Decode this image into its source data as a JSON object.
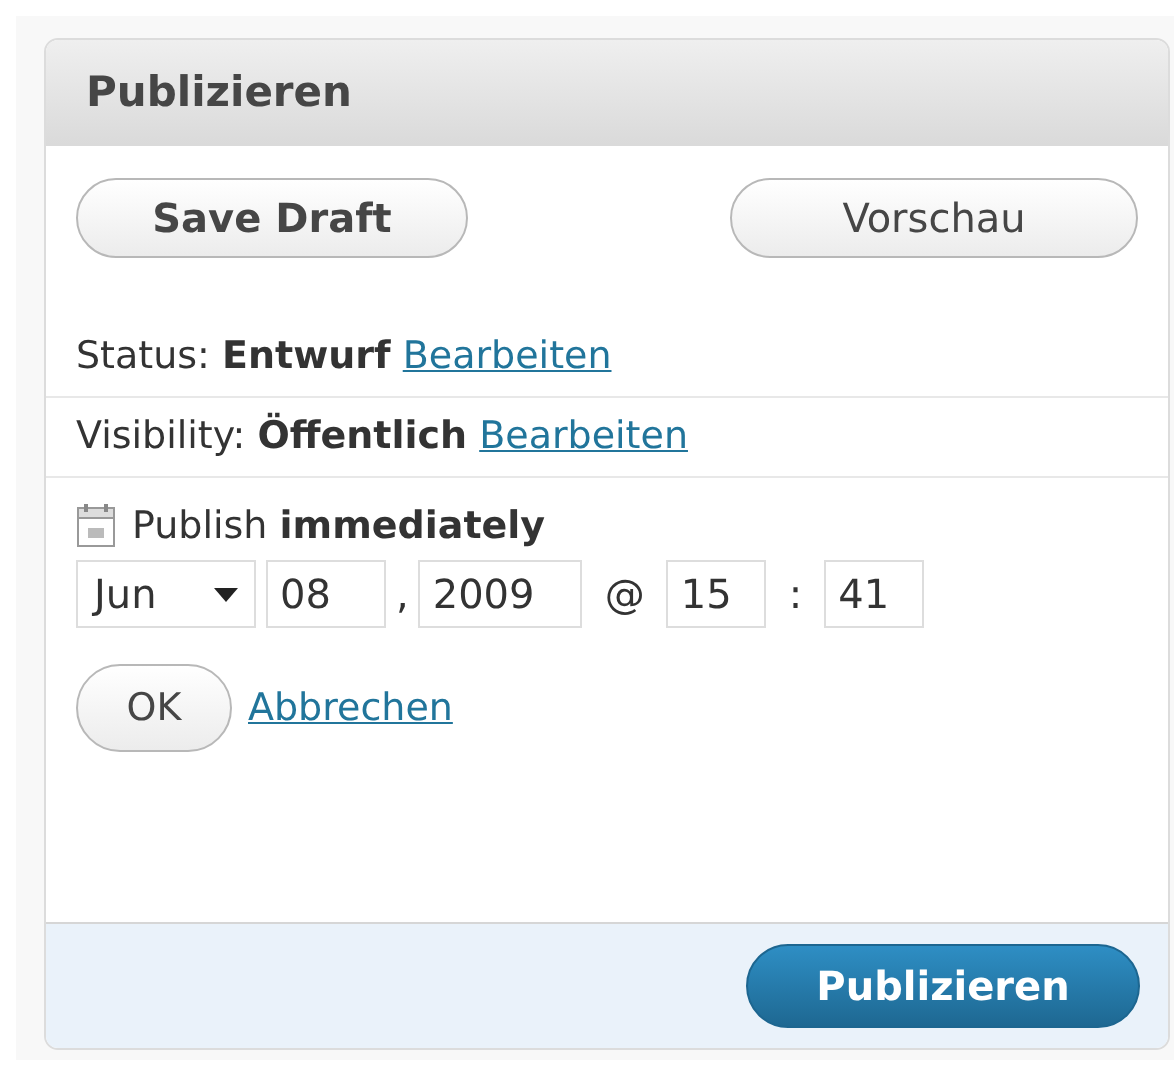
{
  "header": {
    "title": "Publizieren"
  },
  "actions": {
    "save_draft": "Save Draft",
    "preview": "Vorschau"
  },
  "rows": [
    {
      "text": "Status: **Entwurf**",
      "link": "Bearbeiten"
    },
    {
      "text": "Visibility: **Öffentlich**",
      "link": "Bearbeiten"
    }
  ],
  "schedule": {
    "text": "Publish **immediately**",
    "month": "Jun",
    "day": "08",
    "comma": ",",
    "year": "2009",
    "at": "@",
    "hour": "15",
    "colon": ":",
    "minute": "41",
    "ok": "OK",
    "cancel": "Abbrechen"
  },
  "footer": {
    "publish": "Publizieren"
  }
}
